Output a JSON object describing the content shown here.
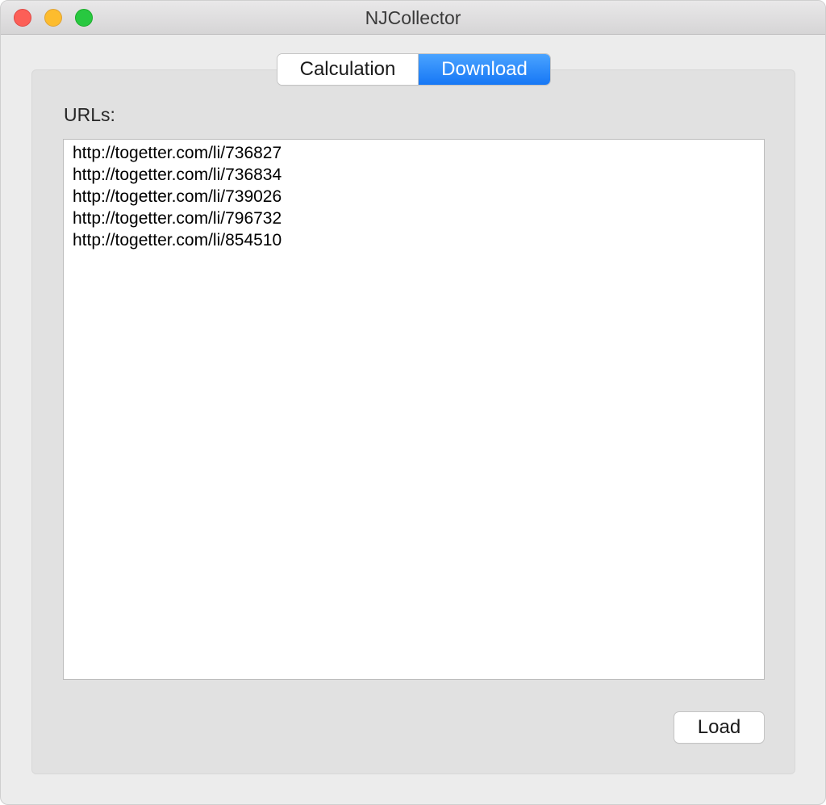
{
  "window": {
    "title": "NJCollector"
  },
  "tabs": [
    {
      "label": "Calculation",
      "selected": false
    },
    {
      "label": "Download",
      "selected": true
    }
  ],
  "download": {
    "urls_label": "URLs:",
    "urls": [
      "http://togetter.com/li/736827",
      "http://togetter.com/li/736834",
      "http://togetter.com/li/739026",
      "http://togetter.com/li/796732",
      "http://togetter.com/li/854510"
    ],
    "load_label": "Load"
  },
  "colors": {
    "accent": "#1677f5",
    "close": "#fc5f57",
    "minimize": "#fdbc2e",
    "zoom": "#28c840"
  },
  "icons": [
    "close-icon",
    "minimize-icon",
    "zoom-icon"
  ]
}
